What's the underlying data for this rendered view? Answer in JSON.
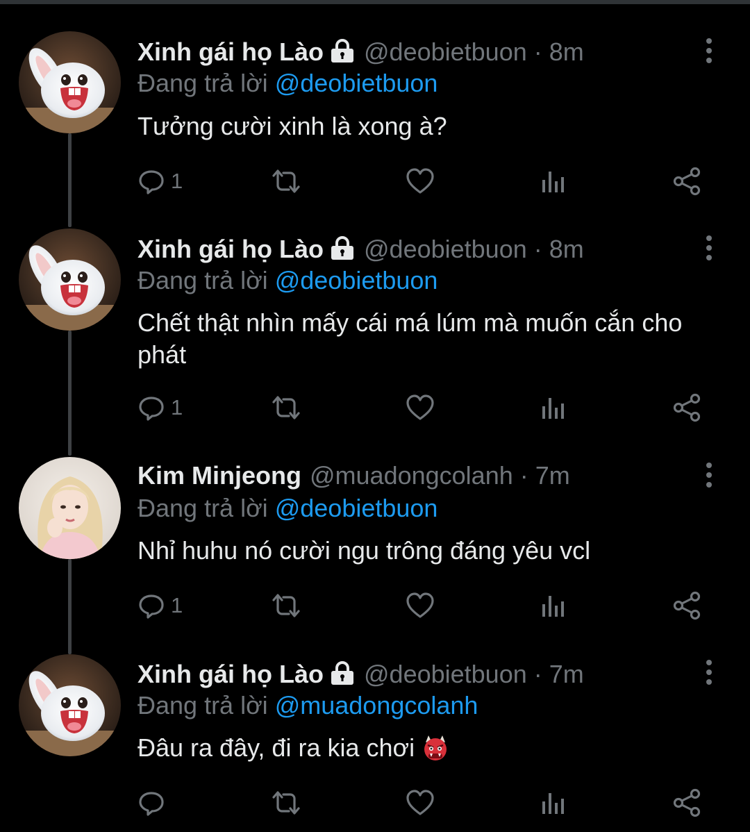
{
  "colors": {
    "background": "#000000",
    "text": "#e7e9ea",
    "muted": "#71767b",
    "link": "#1d9bf0",
    "thread_line": "#3e4144"
  },
  "tweets": [
    {
      "display_name": "Xinh gái họ Lào",
      "protected": true,
      "handle": "@deobietbuon",
      "time": "· 8m",
      "reply_prefix": "Đang trả lời",
      "reply_to": "@deobietbuon",
      "text": "Tưởng cười xinh là xong à?",
      "reply_count": "1",
      "avatar": "white-rabbit-avatar"
    },
    {
      "display_name": "Xinh gái họ Lào",
      "protected": true,
      "handle": "@deobietbuon",
      "time": "· 8m",
      "reply_prefix": "Đang trả lời",
      "reply_to": "@deobietbuon",
      "text": "Chết thật nhìn mấy cái má lúm mà muốn cắn cho phát",
      "reply_count": "1",
      "avatar": "white-rabbit-avatar"
    },
    {
      "display_name": "Kim Minjeong",
      "protected": false,
      "handle": "@muadongcolanh",
      "time": "· 7m",
      "reply_prefix": "Đang trả lời",
      "reply_to": "@deobietbuon",
      "text": "Nhỉ huhu nó cười ngu trông đáng yêu vcl",
      "reply_count": "1",
      "avatar": "girl-photo-avatar"
    },
    {
      "display_name": "Xinh gái họ Lào",
      "protected": true,
      "handle": "@deobietbuon",
      "time": "· 7m",
      "reply_prefix": "Đang trả lời",
      "reply_to": "@muadongcolanh",
      "text": "Đâu ra đây, đi ra kia chơi",
      "emoji": "ogre-emoji",
      "reply_count": "",
      "avatar": "white-rabbit-avatar"
    }
  ],
  "icons": {
    "reply": "reply-icon",
    "retweet": "retweet-icon",
    "like": "heart-icon",
    "views": "views-icon",
    "share": "share-icon",
    "more": "more-icon",
    "lock": "lock-icon"
  }
}
